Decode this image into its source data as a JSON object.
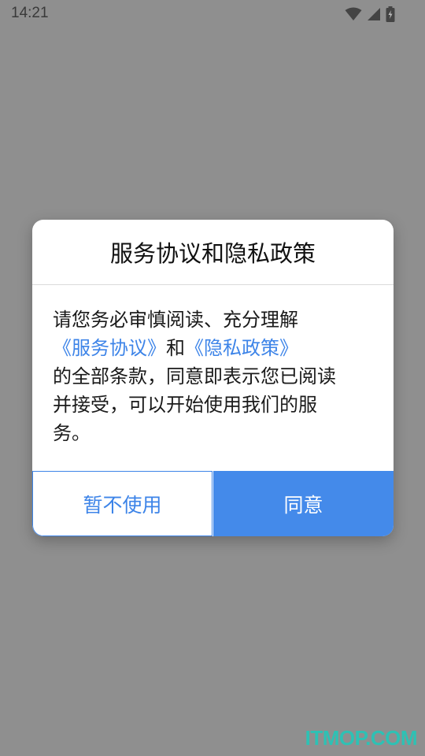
{
  "status_bar": {
    "time": "14:21",
    "icons": [
      "wifi-icon",
      "cell-signal-icon",
      "battery-charging-icon"
    ]
  },
  "dialog": {
    "title": "服务协议和隐私政策",
    "body": {
      "line1": "请您务必审慎阅读、充分理解",
      "link_service": "《服务协议》",
      "conjunction": "和",
      "link_privacy": "《隐私政策》",
      "line3": "的全部条款，同意即表示您已阅读",
      "line4": "并接受，可以开始使用我们的服",
      "line5": "务。"
    },
    "buttons": {
      "decline": "暂不使用",
      "agree": "同意"
    }
  },
  "watermark": "ITMOP.COM",
  "colors": {
    "accent": "#3d84e8",
    "agree_button": "#448aea",
    "overlay": "#8f8f8f",
    "watermark": "#2ec1b4"
  }
}
